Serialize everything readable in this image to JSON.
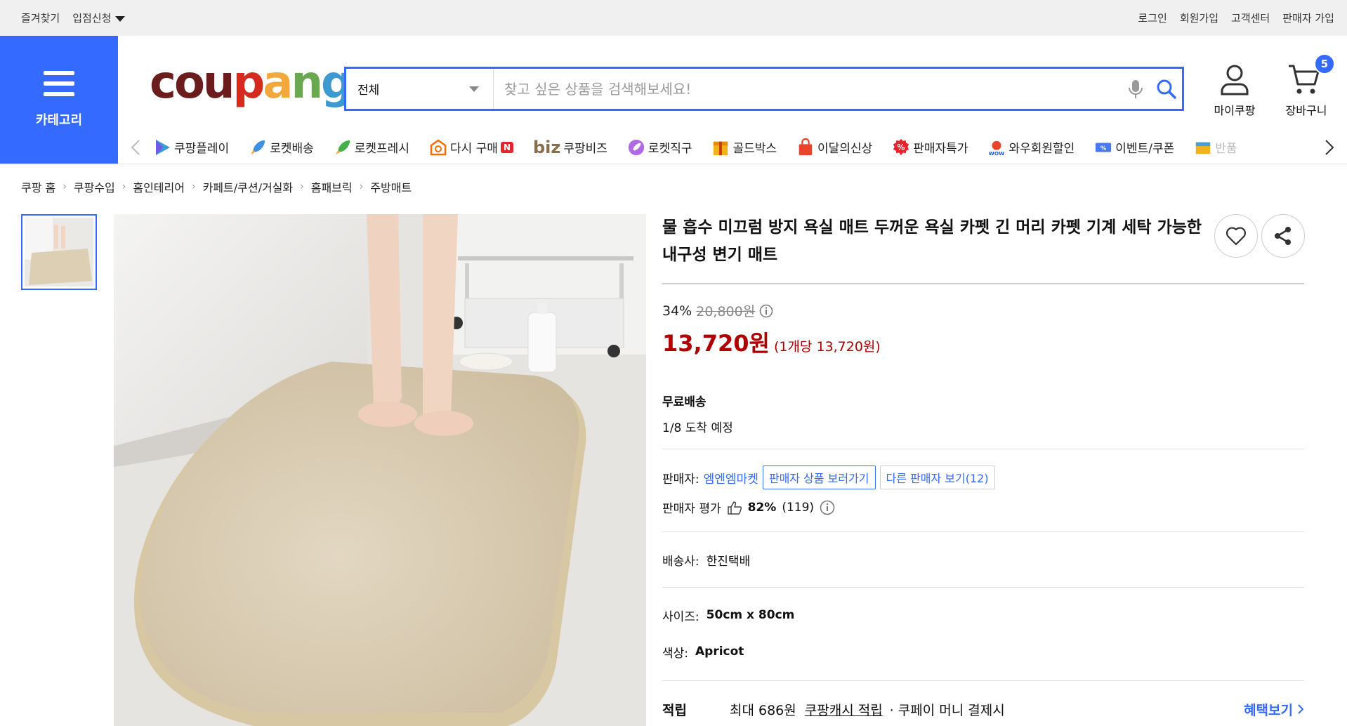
{
  "topbar": {
    "bookmark": "즐겨찾기",
    "store_apply": "입점신청",
    "login": "로그인",
    "signup": "회원가입",
    "service_center": "고객센터",
    "seller_signup": "판매자 가입"
  },
  "header": {
    "category_label": "카테고리",
    "logo_parts": [
      "cou",
      "p",
      "a",
      "n",
      "g"
    ],
    "search_category": "전체",
    "search_placeholder": "찾고 싶은 상품을 검색해보세요!",
    "mycoupang_label": "마이쿠팡",
    "cart_label": "장바구니",
    "cart_count": "5"
  },
  "nav": {
    "items": [
      {
        "label": "쿠팡플레이",
        "icon": "play-icon"
      },
      {
        "label": "로켓배송",
        "icon": "rocket-icon"
      },
      {
        "label": "로켓프레시",
        "icon": "rocket-fresh-icon"
      },
      {
        "label": "다시 구매",
        "icon": "rebuy-icon"
      },
      {
        "label": "쿠팡비즈",
        "icon": "biz-icon"
      },
      {
        "label": "로켓직구",
        "icon": "rocket-global-icon"
      },
      {
        "label": "골드박스",
        "icon": "goldbox-icon"
      },
      {
        "label": "이달의신상",
        "icon": "new-bag-icon"
      },
      {
        "label": "판매자특가",
        "icon": "percent-icon"
      },
      {
        "label": "와우회원할인",
        "icon": "wow-icon"
      },
      {
        "label": "이벤트/쿠폰",
        "icon": "coupon-icon"
      },
      {
        "label": "반품",
        "icon": "return-icon"
      }
    ],
    "rebuy_badge": "N",
    "biz_prefix": "biz"
  },
  "breadcrumb": [
    "쿠팡 홈",
    "쿠팡수입",
    "홈인테리어",
    "카페트/쿠션/거실화",
    "홈패브릭",
    "주방매트"
  ],
  "product": {
    "title": "물 흡수 미끄럼 방지 욕실 매트 두꺼운 욕실 카펫 긴 머리 카펫 기계 세탁 가능한 내구성 변기 매트",
    "discount_rate": "34%",
    "original_price": "20,800원",
    "sale_price": "13,720원",
    "unit_price": "(1개당 13,720원)",
    "shipping_label": "무료배송",
    "delivery_eta": "1/8 도착 예정",
    "seller_label": "판매자:",
    "seller_name": "엠엔엠마켓",
    "seller_products_btn": "판매자 상품 보러가기",
    "other_sellers_btn": "다른 판매자 보기(12)",
    "seller_rating_label": "판매자 평가",
    "seller_rating_pct": "82%",
    "seller_rating_count": "(119)",
    "courier_label": "배송사:",
    "courier_value": "한진택배",
    "size_label": "사이즈:",
    "size_value": "50cm x 80cm",
    "color_label": "색상:",
    "color_value": "Apricot",
    "points_label": "적립",
    "points_max": "최대 686원",
    "points_link": "쿠팡캐시 적립",
    "points_condition": "· 쿠페이 머니 결제시",
    "benefits_link": "혜택보기"
  },
  "colors": {
    "accent": "#346aff",
    "price_red": "#ae0000"
  }
}
